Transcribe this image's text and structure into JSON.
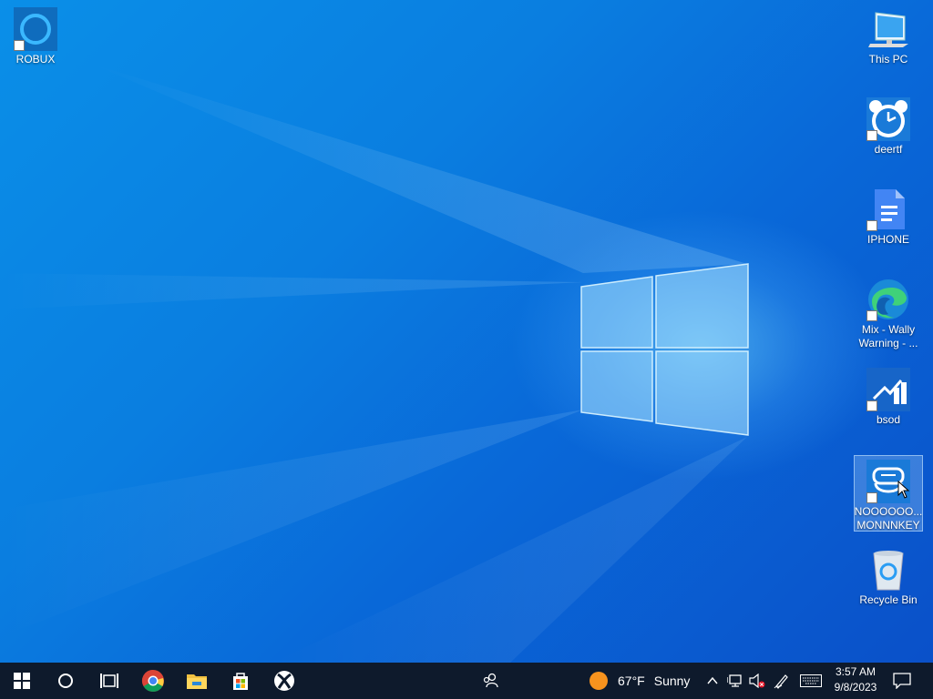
{
  "desktop": {
    "icons": [
      {
        "id": "robux",
        "label": "ROBUX",
        "icon": "cortana-ring-icon"
      },
      {
        "id": "this-pc",
        "label": "This PC",
        "icon": "computer-icon"
      },
      {
        "id": "deertf",
        "label": "deertf",
        "icon": "alarm-clock-icon"
      },
      {
        "id": "iphone",
        "label": "IPHONE",
        "icon": "google-docs-icon"
      },
      {
        "id": "mix",
        "label": "Mix - Wally Warning - ...",
        "icon": "edge-browser-icon"
      },
      {
        "id": "bsod",
        "label": "bsod",
        "icon": "chart-app-icon"
      },
      {
        "id": "monkey",
        "label": "NOOOOOO... MONNNKEY",
        "icon": "vr-headset-icon"
      },
      {
        "id": "recycle",
        "label": "Recycle Bin",
        "icon": "recycle-bin-icon"
      }
    ]
  },
  "taskbar": {
    "start": "windows-start-icon",
    "search": "cortana-search-icon",
    "task_view": "task-view-icon",
    "apps": [
      "chrome-icon",
      "file-explorer-icon",
      "microsoft-store-icon",
      "xbox-icon"
    ],
    "people": "people-icon",
    "weather": {
      "temp": "67°F",
      "condition": "Sunny"
    },
    "clock": {
      "time": "3:57 AM",
      "date": "9/8/2023"
    }
  },
  "colors": {
    "taskbar": "#0e1a2c",
    "desktop_accent": "#0a7ee0"
  }
}
